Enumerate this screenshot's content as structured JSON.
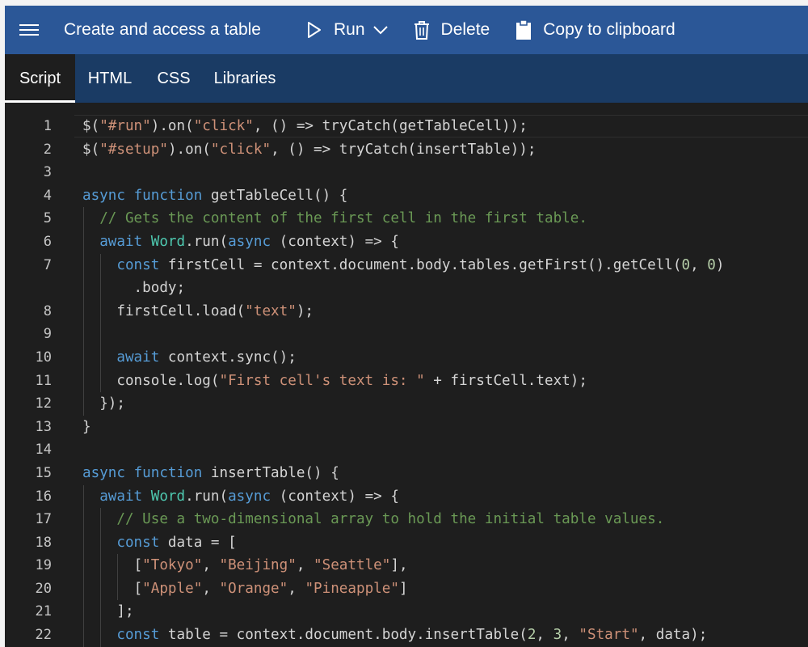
{
  "toolbar": {
    "menu_icon": "hamburger-menu-icon",
    "title": "Create and access a table",
    "run_label": "Run",
    "run_icon": "play-icon",
    "run_dropdown_icon": "chevron-down-icon",
    "delete_label": "Delete",
    "delete_icon": "trash-icon",
    "copy_label": "Copy to clipboard",
    "copy_icon": "clipboard-icon"
  },
  "tabs": [
    {
      "label": "Script",
      "active": true
    },
    {
      "label": "HTML",
      "active": false
    },
    {
      "label": "CSS",
      "active": false
    },
    {
      "label": "Libraries",
      "active": false
    }
  ],
  "colors": {
    "toolbar_bg": "#2b5797",
    "tabs_bg": "#1a3b64",
    "editor_bg": "#1e1e1e",
    "keyword": "#569cd6",
    "string": "#ce9178",
    "comment": "#6a9955",
    "class": "#4ec9b0",
    "number": "#b5cea8",
    "text": "#d4d4d4"
  },
  "editor": {
    "lines": [
      {
        "num": "1",
        "indent": 0,
        "tokens": [
          [
            "plain",
            "$("
          ],
          [
            "str",
            "\"#run\""
          ],
          [
            "plain",
            ").on("
          ],
          [
            "str",
            "\"click\""
          ],
          [
            "plain",
            ", () => tryCatch(getTableCell));"
          ]
        ]
      },
      {
        "num": "2",
        "indent": 0,
        "tokens": [
          [
            "plain",
            "$("
          ],
          [
            "str",
            "\"#setup\""
          ],
          [
            "plain",
            ").on("
          ],
          [
            "str",
            "\"click\""
          ],
          [
            "plain",
            ", () => tryCatch(insertTable));"
          ]
        ]
      },
      {
        "num": "3",
        "indent": 0,
        "tokens": []
      },
      {
        "num": "4",
        "indent": 0,
        "tokens": [
          [
            "kw",
            "async"
          ],
          [
            "plain",
            " "
          ],
          [
            "kw",
            "function"
          ],
          [
            "plain",
            " getTableCell() {"
          ]
        ]
      },
      {
        "num": "5",
        "indent": 1,
        "tokens": [
          [
            "cm",
            "// Gets the content of the first cell in the first table."
          ]
        ]
      },
      {
        "num": "6",
        "indent": 1,
        "tokens": [
          [
            "kw",
            "await"
          ],
          [
            "plain",
            " "
          ],
          [
            "cls",
            "Word"
          ],
          [
            "plain",
            ".run("
          ],
          [
            "kw",
            "async"
          ],
          [
            "plain",
            " (context) => {"
          ]
        ]
      },
      {
        "num": "7",
        "indent": 2,
        "tokens": [
          [
            "kw",
            "const"
          ],
          [
            "plain",
            " firstCell = context.document.body.tables.getFirst().getCell("
          ],
          [
            "num",
            "0"
          ],
          [
            "plain",
            ", "
          ],
          [
            "num",
            "0"
          ],
          [
            "plain",
            ")"
          ]
        ]
      },
      {
        "num": "",
        "indent": 2,
        "tokens": [
          [
            "plain",
            "  .body;"
          ]
        ]
      },
      {
        "num": "8",
        "indent": 2,
        "tokens": [
          [
            "plain",
            "firstCell.load("
          ],
          [
            "str",
            "\"text\""
          ],
          [
            "plain",
            ");"
          ]
        ]
      },
      {
        "num": "9",
        "indent": 2,
        "tokens": []
      },
      {
        "num": "10",
        "indent": 2,
        "tokens": [
          [
            "kw",
            "await"
          ],
          [
            "plain",
            " context.sync();"
          ]
        ]
      },
      {
        "num": "11",
        "indent": 2,
        "tokens": [
          [
            "plain",
            "console.log("
          ],
          [
            "str",
            "\"First cell's text is: \""
          ],
          [
            "plain",
            " + firstCell.text);"
          ]
        ]
      },
      {
        "num": "12",
        "indent": 1,
        "tokens": [
          [
            "plain",
            "});"
          ]
        ]
      },
      {
        "num": "13",
        "indent": 0,
        "tokens": [
          [
            "plain",
            "}"
          ]
        ]
      },
      {
        "num": "14",
        "indent": 0,
        "tokens": []
      },
      {
        "num": "15",
        "indent": 0,
        "tokens": [
          [
            "kw",
            "async"
          ],
          [
            "plain",
            " "
          ],
          [
            "kw",
            "function"
          ],
          [
            "plain",
            " insertTable() {"
          ]
        ]
      },
      {
        "num": "16",
        "indent": 1,
        "tokens": [
          [
            "kw",
            "await"
          ],
          [
            "plain",
            " "
          ],
          [
            "cls",
            "Word"
          ],
          [
            "plain",
            ".run("
          ],
          [
            "kw",
            "async"
          ],
          [
            "plain",
            " (context) => {"
          ]
        ]
      },
      {
        "num": "17",
        "indent": 2,
        "tokens": [
          [
            "cm",
            "// Use a two-dimensional array to hold the initial table values."
          ]
        ]
      },
      {
        "num": "18",
        "indent": 2,
        "tokens": [
          [
            "kw",
            "const"
          ],
          [
            "plain",
            " data = ["
          ]
        ]
      },
      {
        "num": "19",
        "indent": 3,
        "tokens": [
          [
            "plain",
            "["
          ],
          [
            "str",
            "\"Tokyo\""
          ],
          [
            "plain",
            ", "
          ],
          [
            "str",
            "\"Beijing\""
          ],
          [
            "plain",
            ", "
          ],
          [
            "str",
            "\"Seattle\""
          ],
          [
            "plain",
            "],"
          ]
        ]
      },
      {
        "num": "20",
        "indent": 3,
        "tokens": [
          [
            "plain",
            "["
          ],
          [
            "str",
            "\"Apple\""
          ],
          [
            "plain",
            ", "
          ],
          [
            "str",
            "\"Orange\""
          ],
          [
            "plain",
            ", "
          ],
          [
            "str",
            "\"Pineapple\""
          ],
          [
            "plain",
            "]"
          ]
        ]
      },
      {
        "num": "21",
        "indent": 2,
        "tokens": [
          [
            "plain",
            "];"
          ]
        ]
      },
      {
        "num": "22",
        "indent": 2,
        "tokens": [
          [
            "kw",
            "const"
          ],
          [
            "plain",
            " table = context.document.body.insertTable("
          ],
          [
            "num",
            "2"
          ],
          [
            "plain",
            ", "
          ],
          [
            "num",
            "3"
          ],
          [
            "plain",
            ", "
          ],
          [
            "str",
            "\"Start\""
          ],
          [
            "plain",
            ", data);"
          ]
        ]
      }
    ]
  }
}
